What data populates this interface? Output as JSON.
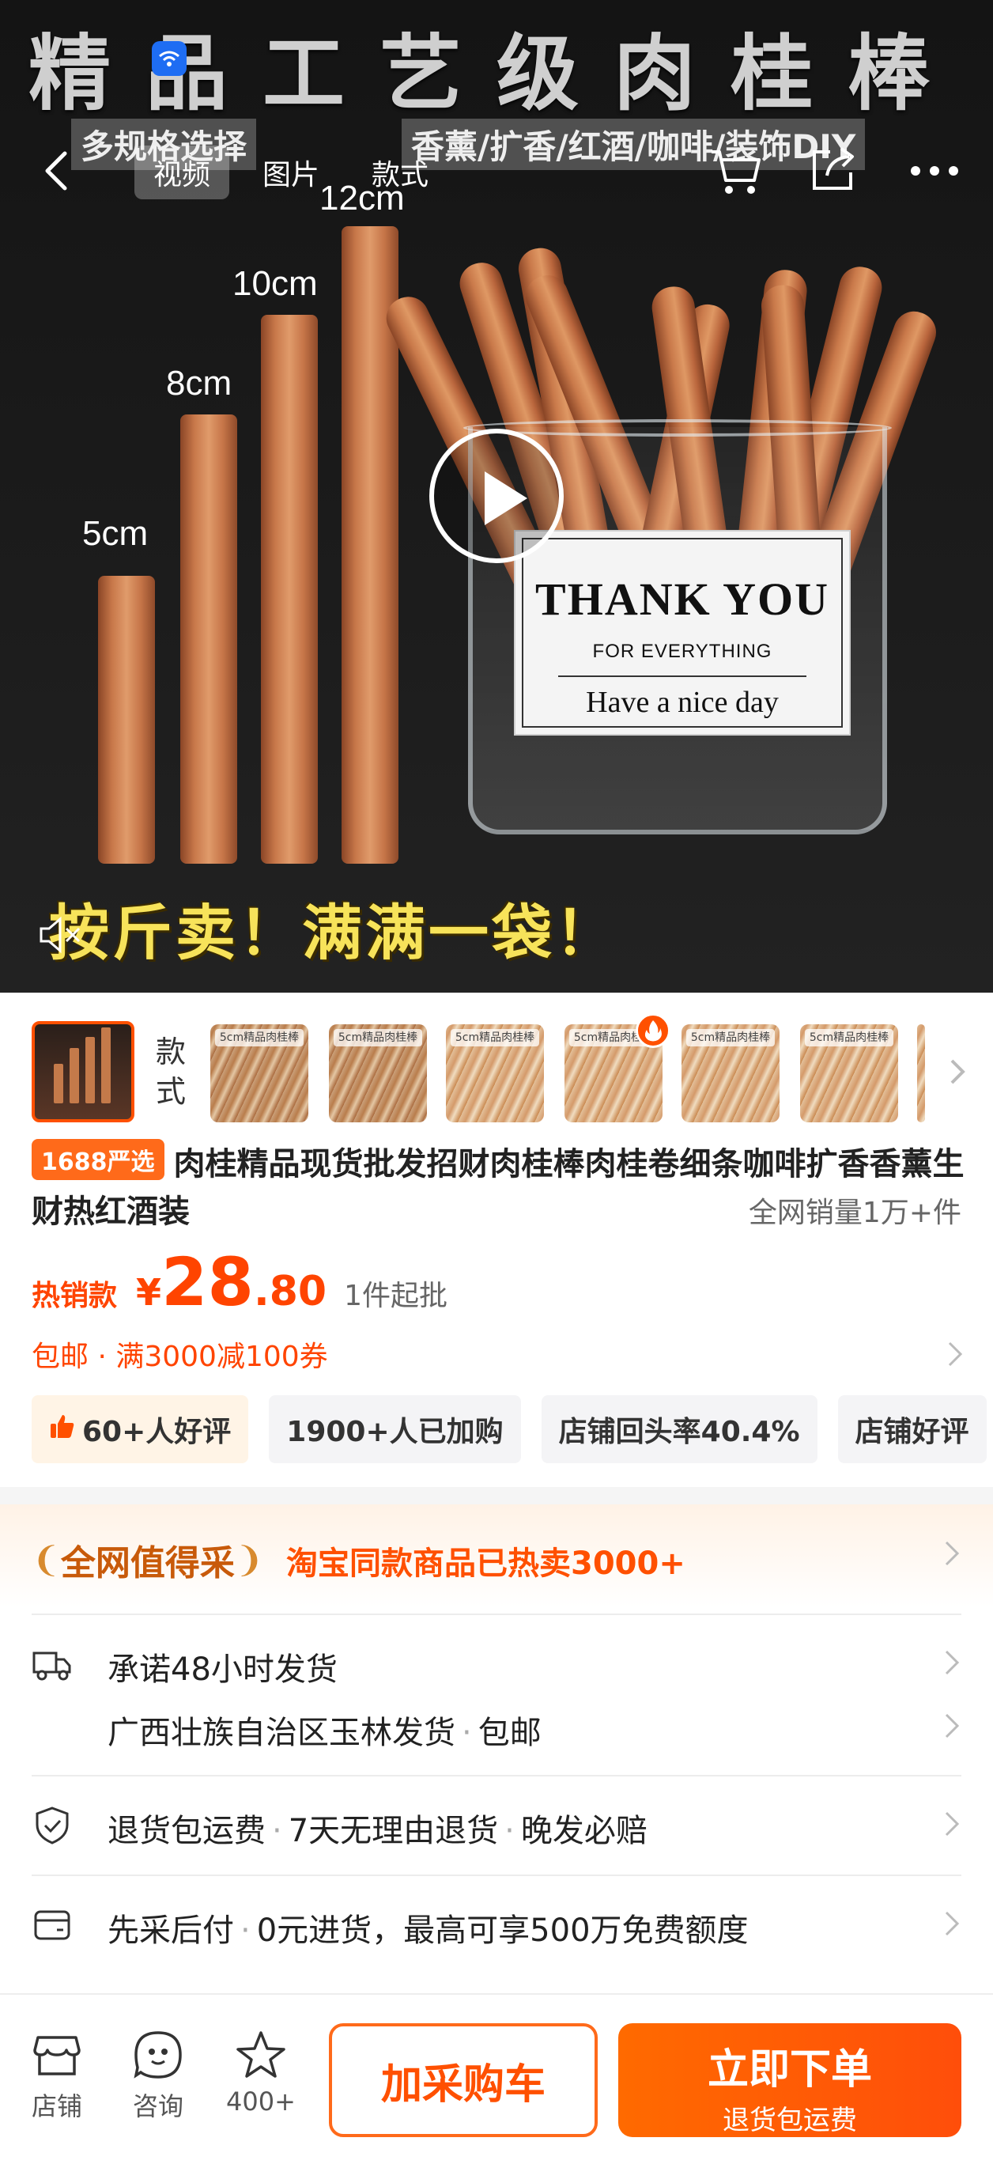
{
  "hero": {
    "title": "精品工艺级肉桂棒",
    "subtitle_left": "多规格选择",
    "subtitle_right": "香薰/扩香/红酒/咖啡/装饰DIY",
    "sizes": [
      "5cm",
      "8cm",
      "10cm",
      "12cm"
    ],
    "card_line1": "THANK YOU",
    "card_line2": "FOR EVERYTHING",
    "card_line3": "Have a nice day",
    "caption": "按斤卖！满满一袋！"
  },
  "media_tabs": [
    {
      "label": "视频",
      "active": true
    },
    {
      "label": "图片",
      "active": false
    },
    {
      "label": "款式",
      "active": false
    }
  ],
  "thumbs": {
    "label": "款式",
    "items": [
      {
        "tag": "5cm精品肉桂棒"
      },
      {
        "tag": "5cm精品肉桂棒"
      },
      {
        "tag": "5cm精品肉桂棒"
      },
      {
        "tag": "5cm精品肉桂棒"
      },
      {
        "tag": "5cm精品肉桂棒"
      },
      {
        "tag": "5cm精品肉桂棒"
      }
    ]
  },
  "product": {
    "badge": "1688严选",
    "title": "肉桂精品现货批发招财肉桂棒肉桂卷细条咖啡扩香香薰生财热红酒装",
    "sales": "全网销量1万+件",
    "hot_tag": "热销款",
    "currency": "¥",
    "price_int": "28",
    "price_dec": ".80",
    "min_order": "1件起批",
    "shipping": "包邮 · 满3000减100券"
  },
  "chips": [
    "60+人好评",
    "1900+人已加购",
    "店铺回头率40.4%",
    "店铺好评"
  ],
  "value_banner": {
    "title": "全网值得采",
    "desc": "淘宝同款商品已热卖3000+"
  },
  "services": {
    "ship_promise": "承诺48小时发货",
    "ship_origin": "广西壮族自治区玉林发货",
    "ship_free": "包邮",
    "ret1": "退货包运费",
    "ret2": "7天无理由退货",
    "ret3": "晚发必赔",
    "pay1": "先采后付",
    "pay2": "0元进货，最高可享500万免费额度"
  },
  "bottom_bar": {
    "shop": "店铺",
    "consult": "咨询",
    "fav_count": "400+",
    "add_cart": "加采购车",
    "buy_now": "立即下单",
    "buy_now_sub": "退货包运费"
  },
  "colors": {
    "accent": "#ff5000",
    "price": "#ff4400",
    "badge": "#ff6a1a"
  }
}
